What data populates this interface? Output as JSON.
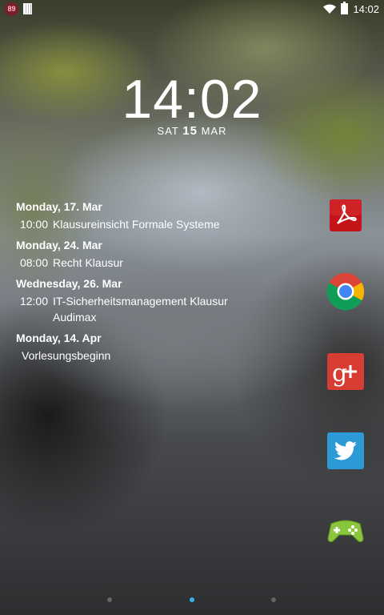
{
  "status_bar": {
    "notification_count": "89",
    "time": "14:02"
  },
  "lockscreen": {
    "clock": "14:02",
    "weekday": "SAT",
    "day": "15",
    "month": "MAR"
  },
  "agenda": [
    {
      "date": "Monday, 17. Mar",
      "events": [
        {
          "time": "10:00",
          "title": "Klausureinsicht Formale Systeme",
          "location": ""
        }
      ]
    },
    {
      "date": "Monday, 24. Mar",
      "events": [
        {
          "time": "08:00",
          "title": "Recht Klausur",
          "location": ""
        }
      ]
    },
    {
      "date": "Wednesday, 26. Mar",
      "events": [
        {
          "time": "12:00",
          "title": "IT-Sicherheitsmanagement Klausur",
          "location": "Audimax"
        }
      ]
    },
    {
      "date": "Monday, 14. Apr",
      "events": [
        {
          "time": "",
          "title": "Vorlesungsbeginn",
          "location": ""
        }
      ]
    }
  ],
  "apps": [
    {
      "name": "pdf-reader-icon"
    },
    {
      "name": "chrome-icon"
    },
    {
      "name": "google-plus-icon"
    },
    {
      "name": "twitter-icon"
    },
    {
      "name": "play-games-icon"
    }
  ],
  "page_indicator": {
    "count": 3,
    "active_index": 1
  },
  "colors": {
    "accent": "#33b5e5"
  }
}
